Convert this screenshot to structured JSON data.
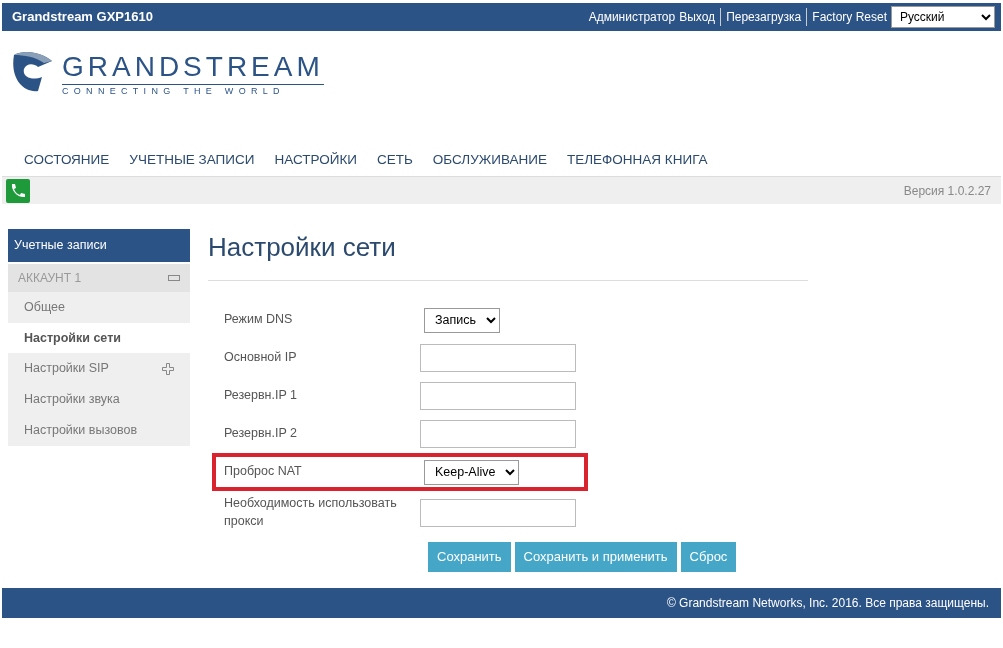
{
  "top_bar": {
    "title": "Grandstream GXP1610",
    "user": "Администратор",
    "links": [
      "Выход",
      "Перезагрузка",
      "Factory Reset"
    ],
    "language": "Русский"
  },
  "logo": {
    "name": "GRANDSTREAM",
    "tagline": "CONNECTING THE WORLD"
  },
  "nav": [
    "СОСТОЯНИЕ",
    "УЧЕТНЫЕ ЗАПИСИ",
    "НАСТРОЙКИ",
    "СЕТЬ",
    "ОБСЛУЖИВАНИЕ",
    "ТЕЛЕФОННАЯ КНИГА"
  ],
  "version": "Версия 1.0.2.27",
  "sidebar": {
    "title": "Учетные записи",
    "items": [
      {
        "label": "АККАУНТ 1",
        "expanded": true,
        "children": [
          {
            "label": "Общее",
            "selected": false
          },
          {
            "label": "Настройки сети",
            "selected": true
          },
          {
            "label": "Настройки SIP",
            "selected": false,
            "expanded": false
          },
          {
            "label": "Настройки звука",
            "selected": false
          },
          {
            "label": "Настройки вызовов",
            "selected": false
          }
        ]
      }
    ]
  },
  "page_title": "Настройки сети",
  "fields": [
    {
      "kind": "select",
      "label": "Режим DNS",
      "value": "Запись",
      "highlighted": false
    },
    {
      "kind": "input",
      "label": "Основной IP",
      "highlighted": false
    },
    {
      "kind": "input",
      "label": "Резервн.IP 1",
      "highlighted": false
    },
    {
      "kind": "input",
      "label": "Резервн.IP 2",
      "highlighted": false
    },
    {
      "kind": "select",
      "label": "Проброс NAT",
      "value": "Keep-Alive",
      "highlighted": true
    },
    {
      "kind": "input",
      "label": "Необходимость использовать прокси",
      "highlighted": false
    }
  ],
  "buttons": [
    "Сохранить",
    "Сохранить и применить",
    "Сброс"
  ],
  "footer": "© Grandstream Networks, Inc. 2016. Все права защищены."
}
